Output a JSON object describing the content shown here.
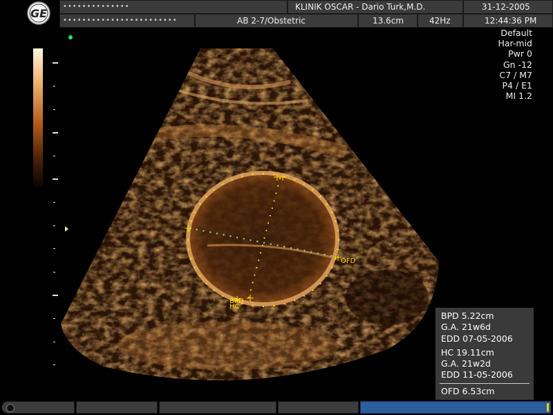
{
  "header": {
    "patient_name_masked": "••••••••••••••",
    "patient_id_masked": "••••••••••••••••••••••••",
    "clinic": "KLINIK OSCAR - Dario Turk,M.D.",
    "date": "31-12-2005",
    "time": "12:44:36 PM",
    "probe_preset": "AB 2-7/Obstetric",
    "depth": "13.6cm",
    "frame_rate": "42Hz",
    "logo_text": "GE"
  },
  "params": [
    "Default",
    "Har-mid",
    "Pwr   0",
    "Gn  -12",
    "C7 / M7",
    "P4 / E1",
    "MI  1.2"
  ],
  "caliper_labels": {
    "bpd_hc": "BPD",
    "hc": "HC",
    "ofd": "OFD"
  },
  "measurements": {
    "bpd": "BPD 5.22cm",
    "bpd_ga": "G.A.  21w6d",
    "bpd_edd": "EDD 07-05-2006",
    "hc": "HC 19.11cm",
    "hc_ga": "G.A.  21w2d",
    "hc_edd": "EDD 11-05-2006",
    "ofd": "OFD 6.53cm"
  },
  "colors": {
    "header_bg": "#3b3b3b",
    "caliper": "#ffe000",
    "ofd_dots": "#9ad6b0",
    "progress": "#2a5e9c",
    "indicator_dot": "#22ee55"
  },
  "progress": {
    "value": 0.99
  }
}
